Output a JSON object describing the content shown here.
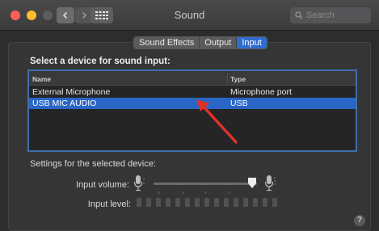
{
  "window": {
    "title": "Sound"
  },
  "search": {
    "placeholder": "Search"
  },
  "tabs": [
    {
      "label": "Sound Effects",
      "active": false
    },
    {
      "label": "Output",
      "active": false
    },
    {
      "label": "Input",
      "active": true
    }
  ],
  "input": {
    "heading": "Select a device for sound input:",
    "columns": {
      "name": "Name",
      "type": "Type"
    },
    "devices": [
      {
        "name": "External Microphone",
        "type": "Microphone port",
        "selected": false
      },
      {
        "name": "USB MIC AUDIO",
        "type": "USB",
        "selected": true
      }
    ],
    "settings_heading": "Settings for the selected device:",
    "volume_label": "Input volume:",
    "level_label": "Input level:",
    "input_volume": 0.95,
    "input_level": 0
  },
  "icons": {
    "back": "chevron-left-icon",
    "forward": "chevron-right-icon",
    "grid": "grid-icon",
    "search": "magnifier-icon",
    "mic_low": "microphone-low-icon",
    "mic_high": "microphone-high-icon",
    "help": "question-mark-icon",
    "annotation": "red-arrow"
  },
  "help": {
    "label": "?"
  },
  "colors": {
    "accent": "#2e6ccd",
    "selected_row": "#2a66c6",
    "annotation_arrow": "#e0302a"
  }
}
